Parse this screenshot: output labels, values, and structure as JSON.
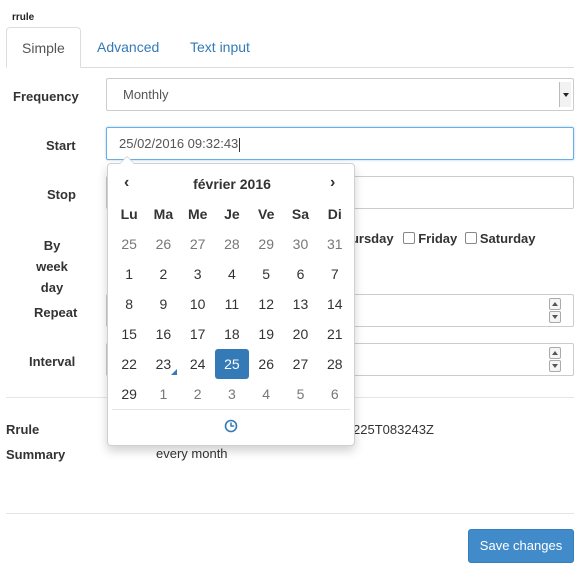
{
  "header": {
    "title": "rrule"
  },
  "tabs": [
    {
      "label": "Simple"
    },
    {
      "label": "Advanced"
    },
    {
      "label": "Text input"
    }
  ],
  "form": {
    "frequency": {
      "label": "Frequency",
      "value": "Monthly"
    },
    "start": {
      "label": "Start",
      "value": "25/02/2016 09:32:43"
    },
    "stop": {
      "label": "Stop",
      "value": ""
    },
    "by_week_day": {
      "label_line1": "By week",
      "label_line2": "day",
      "visible_options": [
        "hursday",
        "Friday",
        "Saturday"
      ]
    },
    "repeat": {
      "label": "Repeat",
      "value": ""
    },
    "interval": {
      "label": "Interval",
      "value": ""
    }
  },
  "result": {
    "rrule_label": "Rrule",
    "rrule_value_visible": "225T083243Z",
    "summary_label": "Summary",
    "summary_value": "every month"
  },
  "footer": {
    "save_label": "Save changes"
  },
  "calendar": {
    "prev": "‹",
    "next": "›",
    "month_title": "février 2016",
    "weekdays": [
      "Lu",
      "Ma",
      "Me",
      "Je",
      "Ve",
      "Sa",
      "Di"
    ],
    "weeks": [
      [
        [
          "25",
          "muted"
        ],
        [
          "26",
          "muted"
        ],
        [
          "27",
          "muted"
        ],
        [
          "28",
          "muted"
        ],
        [
          "29",
          "muted"
        ],
        [
          "30",
          "muted"
        ],
        [
          "31",
          "muted"
        ]
      ],
      [
        [
          "1",
          ""
        ],
        [
          "2",
          ""
        ],
        [
          "3",
          ""
        ],
        [
          "4",
          ""
        ],
        [
          "5",
          ""
        ],
        [
          "6",
          ""
        ],
        [
          "7",
          ""
        ]
      ],
      [
        [
          "8",
          ""
        ],
        [
          "9",
          ""
        ],
        [
          "10",
          ""
        ],
        [
          "11",
          ""
        ],
        [
          "12",
          ""
        ],
        [
          "13",
          ""
        ],
        [
          "14",
          ""
        ]
      ],
      [
        [
          "15",
          ""
        ],
        [
          "16",
          ""
        ],
        [
          "17",
          ""
        ],
        [
          "18",
          ""
        ],
        [
          "19",
          ""
        ],
        [
          "20",
          ""
        ],
        [
          "21",
          ""
        ]
      ],
      [
        [
          "22",
          ""
        ],
        [
          "23",
          "today"
        ],
        [
          "24",
          ""
        ],
        [
          "25",
          "selected"
        ],
        [
          "26",
          ""
        ],
        [
          "27",
          ""
        ],
        [
          "28",
          ""
        ]
      ],
      [
        [
          "29",
          ""
        ],
        [
          "1",
          "muted"
        ],
        [
          "2",
          "muted"
        ],
        [
          "3",
          "muted"
        ],
        [
          "4",
          "muted"
        ],
        [
          "5",
          "muted"
        ],
        [
          "6",
          "muted"
        ]
      ]
    ],
    "time_icon": "clock-icon"
  },
  "colors": {
    "accent": "#337ab7",
    "button": "#428bca"
  }
}
